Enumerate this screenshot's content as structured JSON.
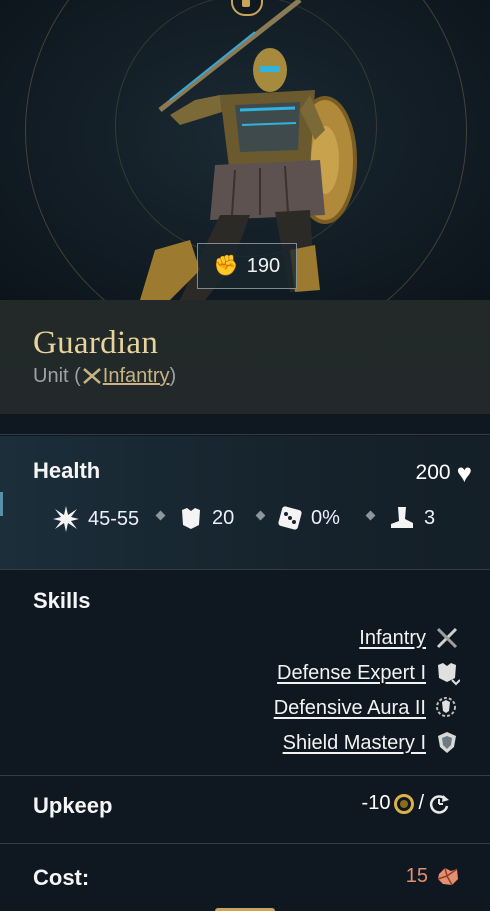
{
  "power": {
    "value": "190",
    "icon": "fist-icon"
  },
  "unit": {
    "name": "Guardian",
    "type_prefix": "Unit (",
    "type_link": "Infantry",
    "type_suffix": ")",
    "type_icon": "crossed-swords-icon"
  },
  "health": {
    "label": "Health",
    "value": "200",
    "icon": "heart-icon"
  },
  "stats": [
    {
      "name": "damage",
      "icon": "burst-icon",
      "value": "45-55"
    },
    {
      "name": "armor",
      "icon": "armor-icon",
      "value": "20"
    },
    {
      "name": "chance",
      "icon": "dice-icon",
      "value": "0%"
    },
    {
      "name": "movement",
      "icon": "boot-icon",
      "value": "3"
    }
  ],
  "skills": {
    "label": "Skills",
    "items": [
      {
        "label": "Infantry",
        "icon": "crossed-swords-icon"
      },
      {
        "label": "Defense Expert I",
        "icon": "armor-upgrade-icon"
      },
      {
        "label": "Defensive Aura II",
        "icon": "aura-icon"
      },
      {
        "label": "Shield Mastery I",
        "icon": "shield-icon"
      }
    ]
  },
  "upkeep": {
    "label": "Upkeep",
    "value": "-10",
    "separator": "/",
    "icons": [
      "gold-icon",
      "turn-icon"
    ]
  },
  "cost": {
    "label": "Cost:",
    "value": "15",
    "icon": "ore-icon"
  },
  "colors": {
    "title_gold": "#e9d39c",
    "link_gold": "#c7b385",
    "cost_red": "#e58e70",
    "background": "#0f1820"
  }
}
